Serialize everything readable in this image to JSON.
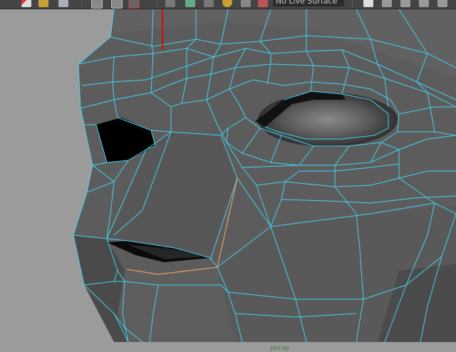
{
  "toolbar": {
    "live_surface": "No Live Surface",
    "icons": [
      "render-icon",
      "open-icon",
      "save-icon",
      "select-icon",
      "lasso-icon",
      "paint-select-icon",
      "grid-snap-icon",
      "curve-snap-icon",
      "point-snap-icon",
      "view-snap-icon",
      "live-icon",
      "history-icon",
      "make-live-icon",
      "camera-icon",
      "render-view-icon",
      "ipr-icon"
    ]
  },
  "viewport": {
    "camera_label": "persp",
    "background_color": "#9b9b9b",
    "mesh_color": "#5b5b5b",
    "wire_color": "#43d3f0",
    "selected_edge_color": "#e8a060",
    "axis_color": "#d01010"
  }
}
